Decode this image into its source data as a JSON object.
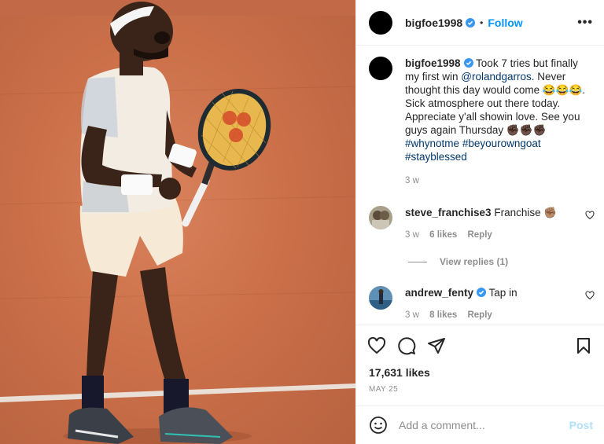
{
  "post": {
    "username": "bigfoe1998",
    "verified": true,
    "follow_label": "Follow",
    "separator": "•",
    "more_label": "•••"
  },
  "caption": {
    "username": "bigfoe1998",
    "text_1": "Took 7 tries but finally my first win ",
    "mention": "@rolandgarros",
    "text_2": ". Never thought this day would come 😂😂😂. Sick atmosphere out there today. Appreciate y'all showin love. See you guys again Thursday ✊🏿✊🏿✊🏿",
    "hashtags": [
      "#whynotme",
      "#beyourowngoat",
      "#stayblessed"
    ],
    "time": "3 w"
  },
  "comments": [
    {
      "username": "steve_franchise3",
      "verified": false,
      "text": "Franchise ✊🏽",
      "time": "3 w",
      "likes": "6 likes",
      "reply_label": "Reply"
    },
    {
      "username": "andrew_fenty",
      "verified": true,
      "text": "Tap in",
      "time": "3 w",
      "likes": "8 likes",
      "reply_label": "Reply"
    }
  ],
  "view_replies": "View replies (1)",
  "likes": "17,631 likes",
  "date": "MAY 25",
  "comment_box": {
    "placeholder": "Add a comment...",
    "post_label": "Post"
  },
  "icons": [
    "verified-icon",
    "heart-icon",
    "comment-icon",
    "share-icon",
    "bookmark-icon",
    "emoji-icon"
  ],
  "colors": {
    "link": "#0095f6",
    "hashtag": "#00376b",
    "muted": "#8e8e8e",
    "court": "#cb7049"
  }
}
